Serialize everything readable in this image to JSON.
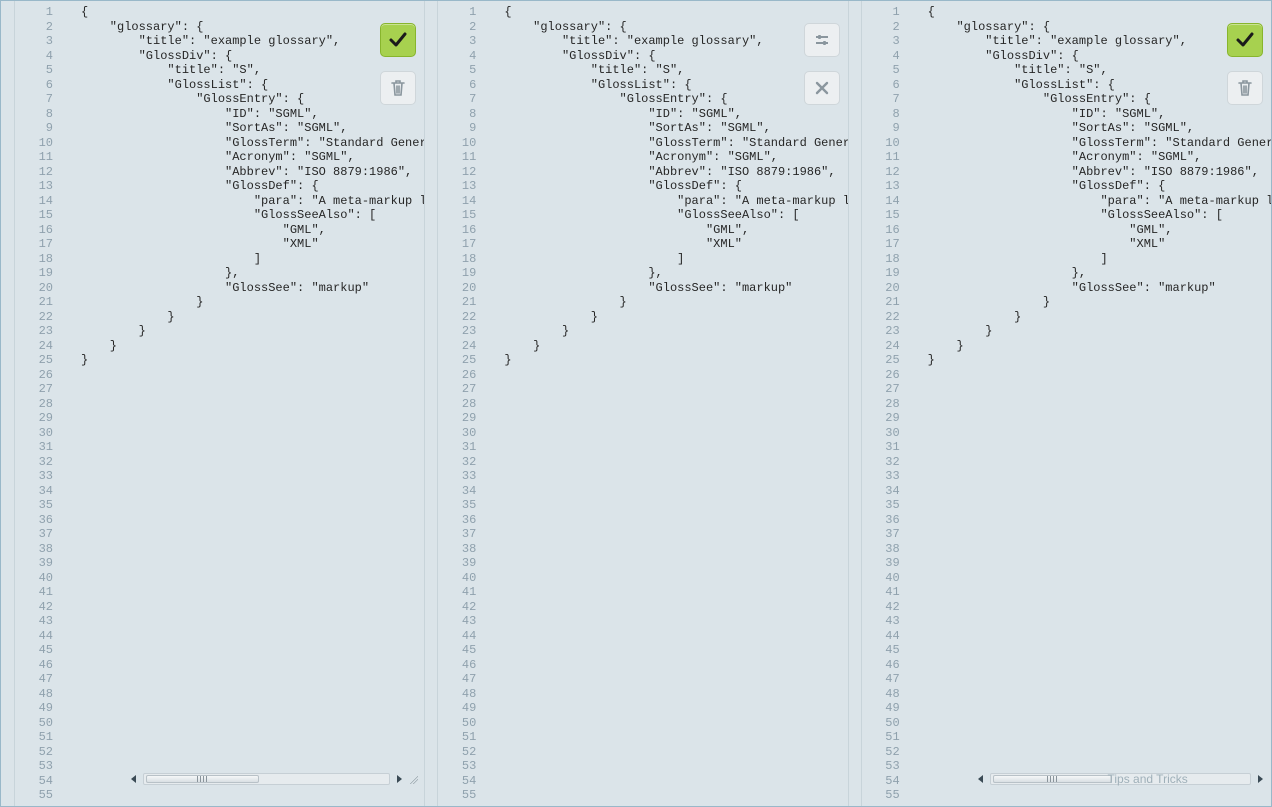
{
  "editor_lines_count": 55,
  "tips_text": "Tips and Tricks",
  "code_full": "{\n    \"glossary\": {\n        \"title\": \"example glossary\",\n        \"GlossDiv\": {\n            \"title\": \"S\",\n            \"GlossList\": {\n                \"GlossEntry\": {\n                    \"ID\": \"SGML\",\n                    \"SortAs\": \"SGML\",\n                    \"GlossTerm\": \"Standard Generalized Markup Language\",\n                    \"Acronym\": \"SGML\",\n                    \"Abbrev\": \"ISO 8879:1986\",\n                    \"GlossDef\": {\n                        \"para\": \"A meta-markup language, used to create markup languages such as DocBook.\",\n                        \"GlossSeeAlso\": [\n                            \"GML\",\n                            \"XML\"\n                        ]\n                    },\n                    \"GlossSee\": \"markup\"\n                }\n            }\n        }\n    }\n}\n",
  "panels": [
    {
      "id": "left",
      "toolbar": [
        {
          "kind": "ok",
          "icon": "check"
        },
        {
          "kind": "subtle",
          "icon": "trash"
        }
      ],
      "has_resize_handle": true,
      "tips": false
    },
    {
      "id": "middle",
      "toolbar": [
        {
          "kind": "subtle",
          "icon": "sliders"
        },
        {
          "kind": "subtle",
          "icon": "close"
        }
      ],
      "no_scrollbar": true,
      "tips": false
    },
    {
      "id": "right",
      "toolbar": [
        {
          "kind": "ok",
          "icon": "check"
        },
        {
          "kind": "subtle",
          "icon": "trash"
        }
      ],
      "tips": true
    }
  ]
}
